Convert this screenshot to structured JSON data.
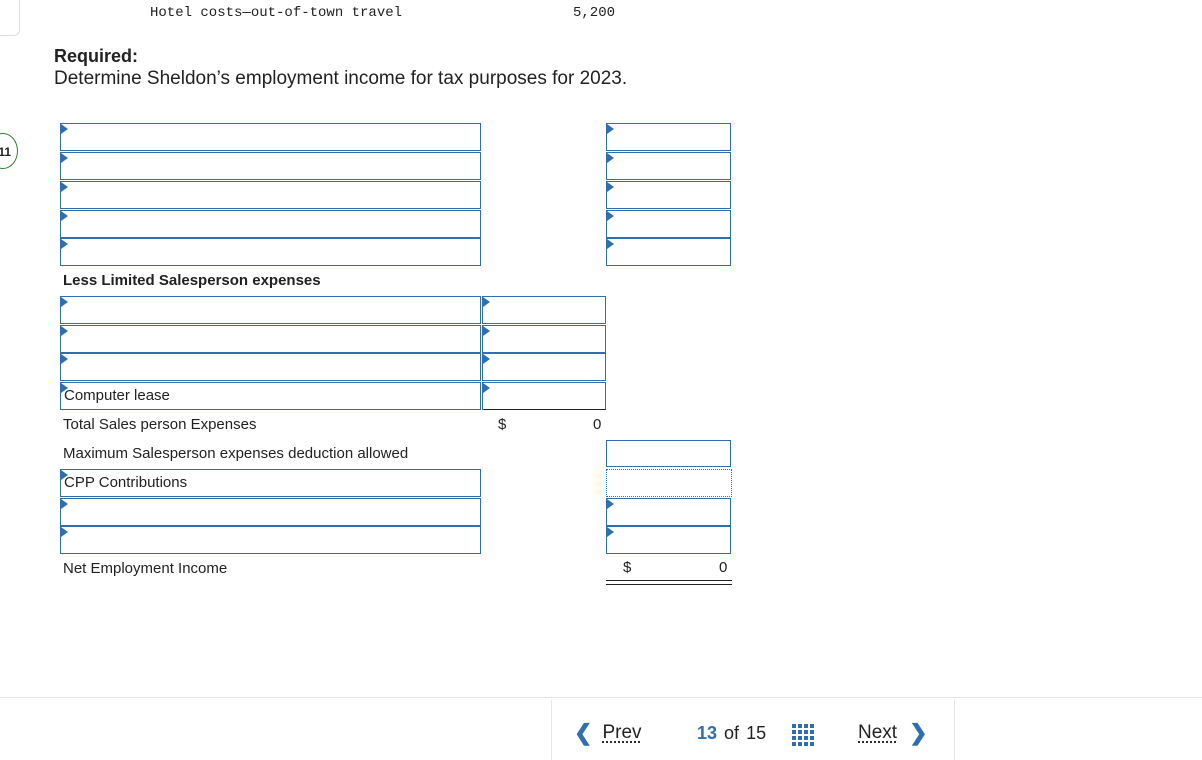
{
  "question_badge": "11",
  "top_row": {
    "label": "Hotel costs—out-of-town travel",
    "value": "5,200"
  },
  "required": {
    "heading": "Required:",
    "description": "Determine Sheldon’s employment income for tax purposes for 2023."
  },
  "worksheet": {
    "less_limited_label": "Less Limited Salesperson expenses",
    "computer_lease": "Computer lease",
    "total_sales_label": "Total Sales person Expenses",
    "total_sales_currency": "$",
    "total_sales_value": "0",
    "max_deduction_label": "Maximum Salesperson expenses deduction allowed",
    "cpp_label": "CPP Contributions",
    "net_income_label": "Net Employment Income",
    "net_income_currency": "$",
    "net_income_value": "0"
  },
  "pagination": {
    "prev": "Prev",
    "current": "13",
    "of": "of",
    "total": "15",
    "next": "Next"
  },
  "icons": {
    "prev": "chevron-left-icon",
    "next": "chevron-right-icon",
    "grid": "grid-icon"
  },
  "colors": {
    "accent": "#2f6fb0",
    "badge_border": "#2e7d32"
  }
}
